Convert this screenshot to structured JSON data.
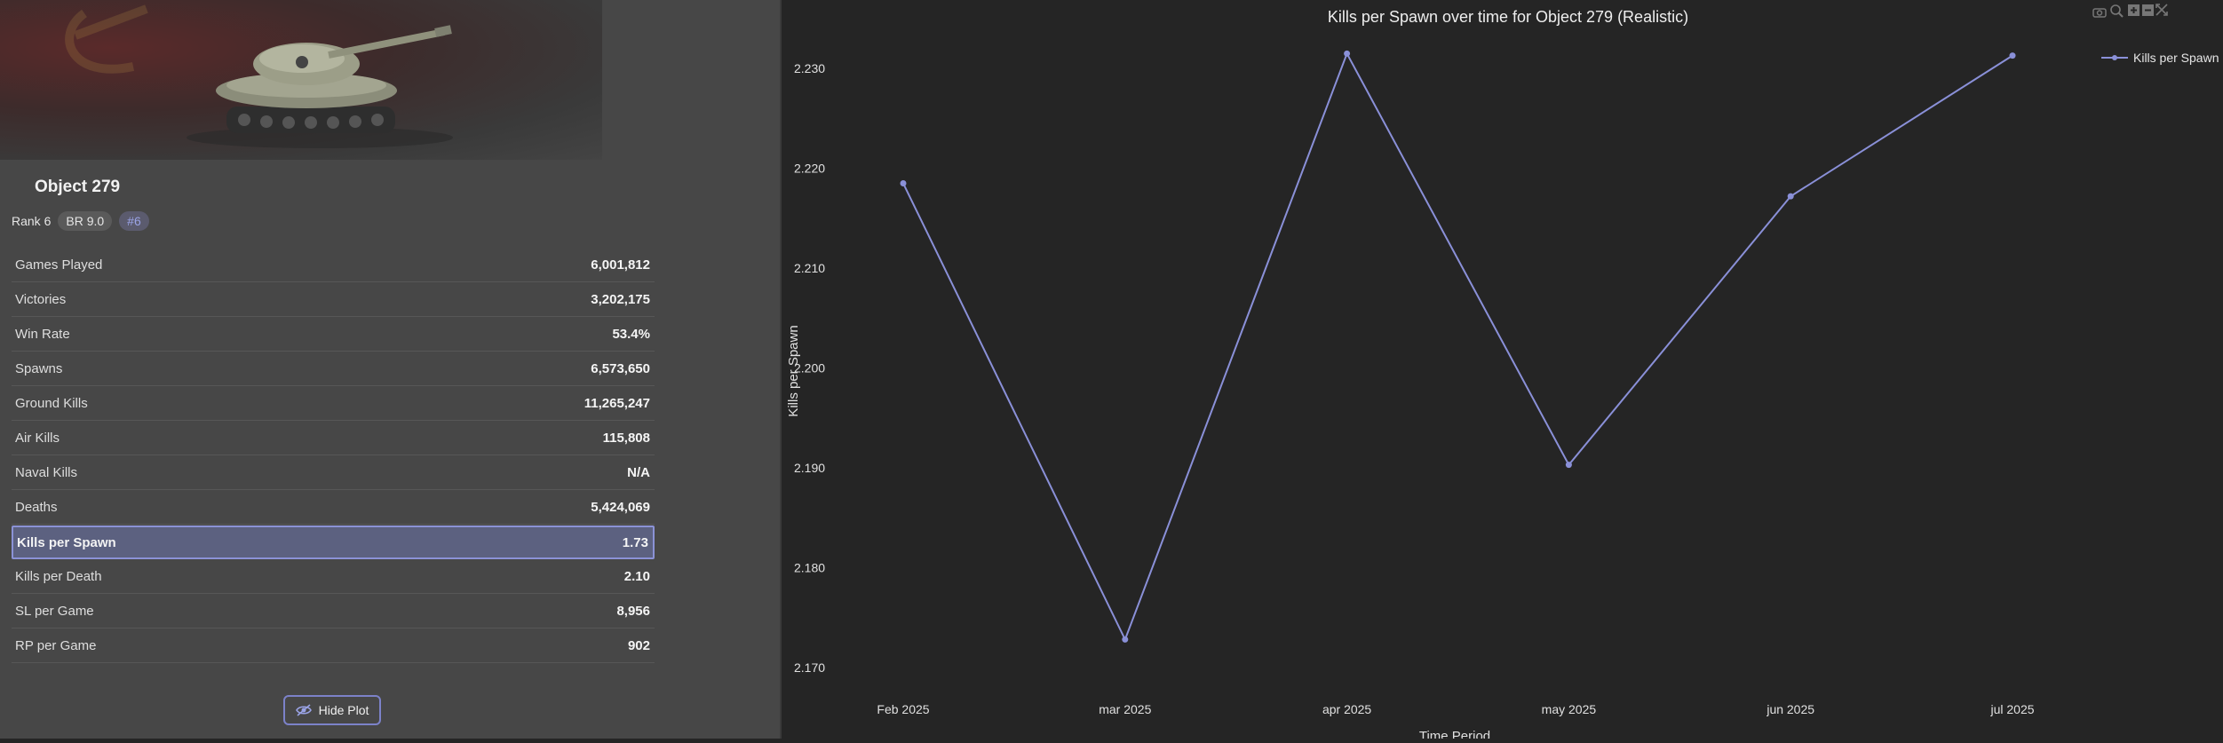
{
  "vehicle": {
    "name": "Object 279",
    "rank": "Rank 6",
    "br": "BR 9.0",
    "position": "#6"
  },
  "stats": [
    {
      "label": "Games Played",
      "value": "6,001,812"
    },
    {
      "label": "Victories",
      "value": "3,202,175"
    },
    {
      "label": "Win Rate",
      "value": "53.4%"
    },
    {
      "label": "Spawns",
      "value": "6,573,650"
    },
    {
      "label": "Ground Kills",
      "value": "11,265,247"
    },
    {
      "label": "Air Kills",
      "value": "115,808"
    },
    {
      "label": "Naval Kills",
      "value": "N/A"
    },
    {
      "label": "Deaths",
      "value": "5,424,069"
    },
    {
      "label": "Kills per Spawn",
      "value": "1.73",
      "highlighted": true
    },
    {
      "label": "Kills per Death",
      "value": "2.10"
    },
    {
      "label": "SL per Game",
      "value": "8,956"
    },
    {
      "label": "RP per Game",
      "value": "902"
    }
  ],
  "hide_plot_label": "Hide Plot",
  "modebar_icons": [
    "camera-icon",
    "zoom-icon",
    "zoom-in-icon",
    "zoom-out-icon",
    "autoscale-icon"
  ],
  "colors": {
    "accent": "#7c82c9",
    "line": "#8a90d8",
    "highlight_bg": "#5c6180"
  },
  "chart_data": {
    "type": "line",
    "title": "Kills per Spawn over time for Object 279 (Realistic)",
    "xlabel": "Time Period",
    "ylabel": "Kills per Spawn",
    "categories": [
      "Feb 2025",
      "mar 2025",
      "apr 2025",
      "may 2025",
      "jun 2025",
      "jul 2025"
    ],
    "series": [
      {
        "name": "Kills per Spawn",
        "values": [
          2.2185,
          2.1728,
          2.2315,
          2.1903,
          2.2172,
          2.2313
        ]
      }
    ],
    "yticks": [
      "2.170",
      "2.180",
      "2.190",
      "2.200",
      "2.210",
      "2.220",
      "2.230"
    ],
    "ylim": [
      2.1675,
      2.2342
    ],
    "grid": false,
    "legend_position": "top-right"
  }
}
